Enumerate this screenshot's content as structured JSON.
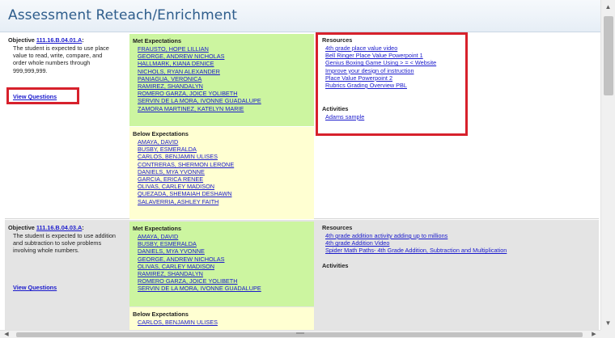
{
  "header": {
    "title": "Assessment Reteach/Enrichment"
  },
  "objectives": [
    {
      "prefix": "Objective ",
      "code": "111.16.B.04.01.A",
      "suffix": ":",
      "description": "The student is expected to use place value to read, write, compare, and order whole numbers through 999,999,999.",
      "view_questions": "View Questions",
      "met_heading": "Met Expectations",
      "met": [
        "FRAUSTO, HOPE LILLIAN",
        "GEORGE, ANDREW NICHOLAS",
        "HALLMARK, KIANA DENICE",
        "NICHOLS, RYAN ALEXANDER",
        "PANIAGUA, VERONICA",
        "RAMIREZ, SHANDALYN",
        "ROMERO GARZA, JOICE YOLIBETH",
        "SERVIN DE LA MORA, IVONNE GUADALUPE",
        "ZAMORA MARTINEZ, KATELYN MARIE"
      ],
      "below_heading": "Below Expectations",
      "below": [
        "AMAYA, DAVID",
        "BUSBY, ESMERALDA",
        "CARLOS, BENJAMIN ULISES",
        "CONTRERAS, SHERMON LERONE",
        "DANIELS, MYA YVONNE",
        "GARCIA, ERICA RENEE",
        "OLIVAS, CARLEY MADISON",
        "QUEZADA, SHEMAIAH DESHAWN",
        "SALAVERRIA, ASHLEY FAITH"
      ],
      "resources_heading": "Resources",
      "resources": [
        "4th grade place value video",
        "Bell Ringer Place Value Powerpoint 1",
        "Genius Boxing Game Using > = < Website",
        "Improve your design of instruction",
        "Place Value Powerpoint 2",
        "Rubrics Grading Overview PBL"
      ],
      "activities_heading": "Activities",
      "activities": [
        "Adams sample"
      ]
    },
    {
      "prefix": "Objective ",
      "code": "111.16.B.04.03.A",
      "suffix": ":",
      "description": "The student is expected to use addition and subtraction to solve problems involving whole numbers.",
      "view_questions": "View Questions",
      "met_heading": "Met Expectations",
      "met": [
        "AMAYA, DAVID",
        "BUSBY, ESMERALDA",
        "DANIELS, MYA YVONNE",
        "GEORGE, ANDREW NICHOLAS",
        "OLIVAS, CARLEY MADISON",
        "RAMIREZ, SHANDALYN",
        "ROMERO GARZA, JOICE YOLIBETH",
        "SERVIN DE LA MORA, IVONNE GUADALUPE"
      ],
      "below_heading": "Below Expectations",
      "below": [
        "CARLOS, BENJAMIN ULISES"
      ],
      "resources_heading": "Resources",
      "resources": [
        "4th grade addition activity adding up to millions",
        "4th grade Addition Video",
        "Spider Math Paths- 4th Grade Addition, Subtraction and Multiplication"
      ],
      "activities_heading": "Activities",
      "activities": []
    }
  ],
  "scrollbars": {
    "up_glyph": "▲",
    "down_glyph": "▼",
    "left_glyph": "◀",
    "right_glyph": "▶"
  },
  "colors": {
    "title": "#2e5d8c",
    "link": "#1a1acc",
    "met_bg": "#ccf5a0",
    "below_bg": "#ffffd2",
    "highlight": "#d7212c"
  }
}
